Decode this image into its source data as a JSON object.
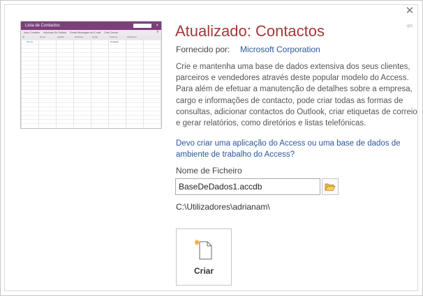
{
  "dialog": {
    "close_glyph": "✕",
    "corner_mark": "-ps"
  },
  "thumbnail": {
    "title": "Lista de Contactos",
    "toolbar": [
      "Novo Contacto",
      "Adicionar Do Outlook",
      "Enviar Mensagem de E-mail",
      "Criar Correio"
    ],
    "help": "?",
    "columns": [
      "ID",
      "Nome",
      "Apelido",
      "Empresa",
      "Cargo",
      "Telefone",
      "Telemóvel"
    ],
    "new_row_link": "(Novo)",
    "cell_text": "Contacto"
  },
  "template": {
    "title": "Atualizado: Contactos",
    "provider_label": "Fornecido por:",
    "provider_name": "Microsoft Corporation",
    "description": "Crie e mantenha uma base de dados extensiva dos seus clientes, parceiros e vendedores através deste popular modelo do Access. Para além de efetuar a manutenção de detalhes sobre a empresa, cargo e informações de contacto, pode criar todas as formas de consultas, adicionar contactos do Outlook, criar etiquetas de correio e gerar relatórios, como diretórios e listas telefónicas.",
    "help_link": "Devo criar uma aplicação do Access ou uma base de dados de ambiente de trabalho do Access?"
  },
  "file": {
    "label": "Nome de Ficheiro",
    "value": "BaseDeDados1.accdb",
    "path": "C:\\Utilizadores\\adrianam\\"
  },
  "actions": {
    "create_label": "Criar"
  },
  "colors": {
    "title": "#a4373a",
    "link": "#2b579a",
    "thumbnail_header": "#7b3f7a"
  }
}
